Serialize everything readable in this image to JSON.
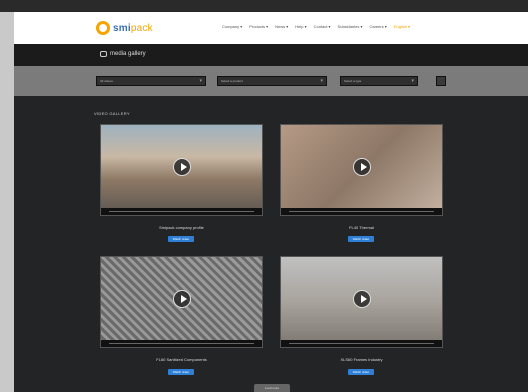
{
  "header": {
    "logo": {
      "brand": "smi",
      "suffix": "pack"
    },
    "nav": [
      {
        "label": "Company ▾",
        "active": false
      },
      {
        "label": "Products ▾",
        "active": false
      },
      {
        "label": "News ▾",
        "active": false
      },
      {
        "label": "Help ▾",
        "active": false
      },
      {
        "label": "Contact ▾",
        "active": false
      },
      {
        "label": "Subsidiaries ▾",
        "active": false
      },
      {
        "label": "Careers ▾",
        "active": false
      },
      {
        "label": "English ▾",
        "active": true
      }
    ]
  },
  "band": {
    "title": "media gallery"
  },
  "filters": [
    {
      "value": "All videos"
    },
    {
      "value": "Select a product"
    },
    {
      "value": "Select a type"
    }
  ],
  "section_label": "VIDEO GALLERY",
  "videos": [
    {
      "caption": "Smipack company profile",
      "button": "Watch video"
    },
    {
      "caption": "FL40 Thermal",
      "button": "Watch video"
    },
    {
      "caption": "FL60 Sanitized Components",
      "button": "Watch video"
    },
    {
      "caption": "XLS60 Frames Industry",
      "button": "Watch video"
    }
  ],
  "load_more": "Load more",
  "colors": {
    "accent": "#f5a400",
    "brand_blue": "#3a6fb0",
    "button_blue": "#2f7fd6"
  }
}
